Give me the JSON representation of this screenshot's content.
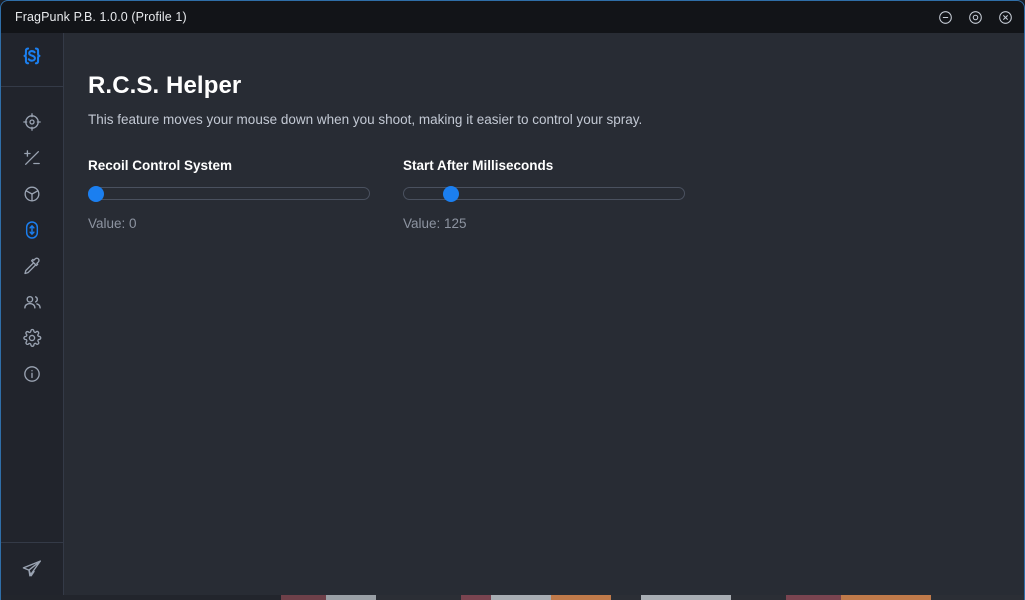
{
  "window": {
    "title": "FragPunk P.B. 1.0.0 (Profile 1)",
    "accent_color": "#1b7ff0",
    "border_color": "#2f6ea8",
    "titlebar_bg": "#121418",
    "sidebar_bg": "#21242c",
    "content_bg": "#282c34",
    "controls": [
      {
        "name": "minimize-button",
        "glyph": "minus-circle-icon",
        "label": "Minimize"
      },
      {
        "name": "maximize-button",
        "glyph": "target-circle-icon",
        "label": "Maximize"
      },
      {
        "name": "close-button",
        "glyph": "close-circle-icon",
        "label": "Close"
      }
    ]
  },
  "sidebar": {
    "logo": {
      "name": "app-logo-icon",
      "label": "S"
    },
    "items": [
      {
        "name": "sidebar-item-aimbot",
        "icon": "crosshair-target-icon",
        "label": "Aimbot",
        "active": false
      },
      {
        "name": "sidebar-item-plus-minus",
        "icon": "plus-minus-icon",
        "label": "Adjustments",
        "active": false
      },
      {
        "name": "sidebar-item-circle-crosshair",
        "icon": "circle-crosshair-icon",
        "label": "Crosshair",
        "active": false
      },
      {
        "name": "sidebar-item-rcs",
        "icon": "mouse-recoil-icon",
        "label": "R.C.S. Helper",
        "active": true
      },
      {
        "name": "sidebar-item-color-picker",
        "icon": "eyedropper-icon",
        "label": "Color Picker",
        "active": false
      },
      {
        "name": "sidebar-item-users",
        "icon": "users-icon",
        "label": "Users",
        "active": false
      },
      {
        "name": "sidebar-item-settings",
        "icon": "gear-icon",
        "label": "Settings",
        "active": false
      },
      {
        "name": "sidebar-item-info",
        "icon": "info-circle-icon",
        "label": "Info",
        "active": false
      }
    ],
    "footer": {
      "name": "telegram-link",
      "icon": "paper-plane-icon",
      "label": "Telegram"
    }
  },
  "main": {
    "title": "R.C.S. Helper",
    "subtitle": "This feature moves your mouse down when you shoot, making it easier to control your spray.",
    "sliders": [
      {
        "name": "recoil-control-system",
        "label": "Recoil Control System",
        "value_text": "Value: 0",
        "value": 0,
        "min": 0,
        "max": 100,
        "percent": 0
      },
      {
        "name": "start-after-milliseconds",
        "label": "Start After Milliseconds",
        "value_text": "Value: 125",
        "value": 125,
        "min": 0,
        "max": 1000,
        "percent": 15
      }
    ]
  }
}
